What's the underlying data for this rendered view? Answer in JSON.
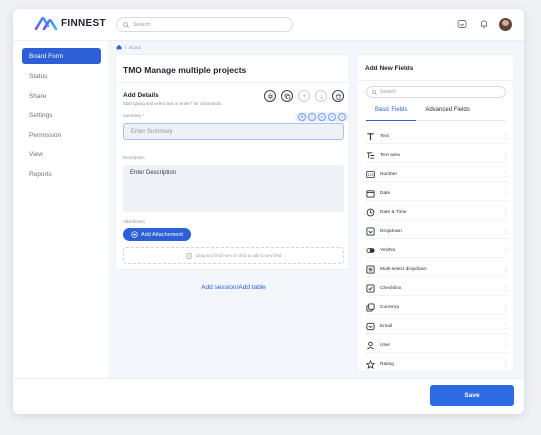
{
  "app": {
    "brand": "FINNEST"
  },
  "header": {
    "search_placeholder": "Search"
  },
  "sidebar": {
    "items": [
      {
        "label": "Board Form",
        "active": true
      },
      {
        "label": "Status"
      },
      {
        "label": "Share"
      },
      {
        "label": "Settings"
      },
      {
        "label": "Permission"
      },
      {
        "label": "View"
      },
      {
        "label": "Reports"
      }
    ]
  },
  "breadcrumb": {
    "current": "Board"
  },
  "form": {
    "title": "TMO Manage multiple projects",
    "add_details": "Add Details",
    "add_details_hint": "Start typing and select text or enter'/' for commands.",
    "summary_label": "Summary *",
    "summary_placeholder": "Enter Summary",
    "description_label": "Description",
    "description_placeholder": "Enter Description",
    "attachment_label": "Attachment",
    "add_attachment": "Add Attachement",
    "dropzone_text": "Drag any field here or click to add a new field",
    "add_session": "Add session/Add table"
  },
  "fields_panel": {
    "title": "Add New Fields",
    "search_placeholder": "Search",
    "tabs": [
      "Basic Fields",
      "Advanced Fields"
    ],
    "items": [
      {
        "label": "Text",
        "icon": "text-icon"
      },
      {
        "label": "Text area",
        "icon": "text-area-icon"
      },
      {
        "label": "Number",
        "icon": "number-icon"
      },
      {
        "label": "Date",
        "icon": "calendar-icon"
      },
      {
        "label": "Date & Time",
        "icon": "clock-icon"
      },
      {
        "label": "Dropdown",
        "icon": "dropdown-icon"
      },
      {
        "label": "Yes/No",
        "icon": "toggle-icon"
      },
      {
        "label": "Multi-select dropdown",
        "icon": "multi-select-icon"
      },
      {
        "label": "Checkbox",
        "icon": "checkbox-icon"
      },
      {
        "label": "Currency",
        "icon": "currency-icon"
      },
      {
        "label": "Email",
        "icon": "email-icon"
      },
      {
        "label": "User",
        "icon": "user-icon"
      },
      {
        "label": "Rating",
        "icon": "star-icon"
      }
    ]
  },
  "footer": {
    "save_label": "Save"
  },
  "colors": {
    "primary": "#2d5fd6",
    "background": "#f3f6fb"
  }
}
